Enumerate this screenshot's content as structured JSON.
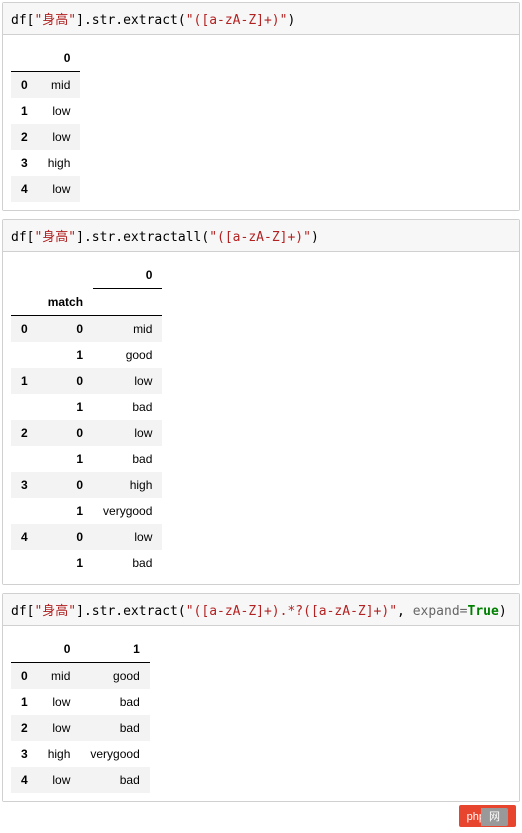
{
  "cell1": {
    "code": {
      "obj": "df",
      "col": "\"身高\"",
      "accessor": ".str.extract",
      "regex": "\"([a-zA-Z]+)\""
    },
    "output": {
      "columns": [
        "0"
      ],
      "rows": [
        {
          "idx": "0",
          "v": "mid"
        },
        {
          "idx": "1",
          "v": "low"
        },
        {
          "idx": "2",
          "v": "low"
        },
        {
          "idx": "3",
          "v": "high"
        },
        {
          "idx": "4",
          "v": "low"
        }
      ]
    }
  },
  "cell2": {
    "code": {
      "obj": "df",
      "col": "\"身高\"",
      "accessor": ".str.extractall",
      "regex": "\"([a-zA-Z]+)\""
    },
    "output": {
      "sub_index_label": "match",
      "columns": [
        "0"
      ],
      "rows": [
        {
          "g": "0",
          "m": "0",
          "v": "mid"
        },
        {
          "g": "",
          "m": "1",
          "v": "good"
        },
        {
          "g": "1",
          "m": "0",
          "v": "low"
        },
        {
          "g": "",
          "m": "1",
          "v": "bad"
        },
        {
          "g": "2",
          "m": "0",
          "v": "low"
        },
        {
          "g": "",
          "m": "1",
          "v": "bad"
        },
        {
          "g": "3",
          "m": "0",
          "v": "high"
        },
        {
          "g": "",
          "m": "1",
          "v": "verygood"
        },
        {
          "g": "4",
          "m": "0",
          "v": "low"
        },
        {
          "g": "",
          "m": "1",
          "v": "bad"
        }
      ]
    }
  },
  "cell3": {
    "code": {
      "obj": "df",
      "col": "\"身高\"",
      "accessor": ".str.extract",
      "regex": "\"([a-zA-Z]+).*?([a-zA-Z]+)\"",
      "kw_name": "expand",
      "kw_val": "True"
    },
    "output": {
      "columns": [
        "0",
        "1"
      ],
      "rows": [
        {
          "idx": "0",
          "c0": "mid",
          "c1": "good"
        },
        {
          "idx": "1",
          "c0": "low",
          "c1": "bad"
        },
        {
          "idx": "2",
          "c0": "low",
          "c1": "bad"
        },
        {
          "idx": "3",
          "c0": "high",
          "c1": "verygood"
        },
        {
          "idx": "4",
          "c0": "low",
          "c1": "bad"
        }
      ]
    }
  },
  "watermark": {
    "a": "php",
    "b": "网"
  }
}
